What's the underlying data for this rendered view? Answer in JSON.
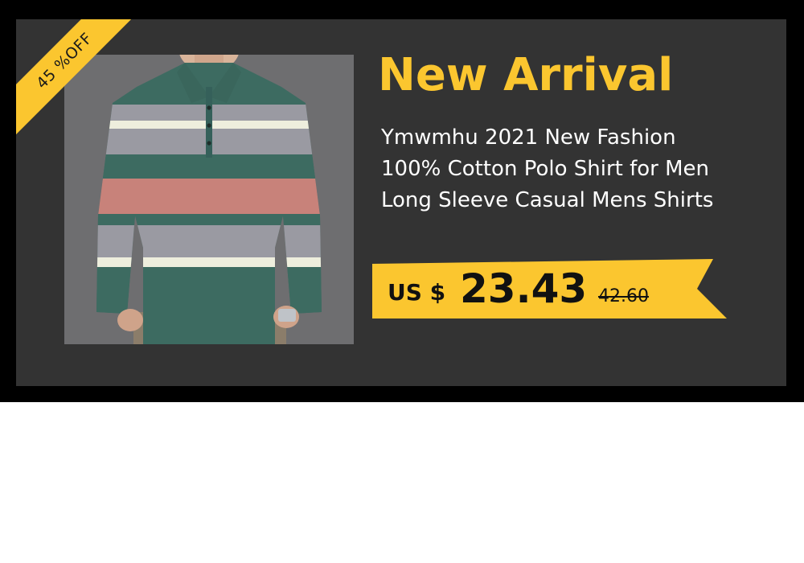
{
  "banner": {
    "discount_label": "45 %OFF",
    "headline": "New Arrival",
    "title_lines": [
      "Ymwmhu 2021 New Fashion",
      "100% Cotton Polo Shirt for Men",
      "Long Sleeve Casual Mens Shirts"
    ],
    "price": {
      "currency": "US $",
      "current": "23.43",
      "original": "42.60"
    },
    "colors": {
      "accent": "#fbc62f",
      "panel": "#333333",
      "frame": "#000000",
      "shirt_green": "#3d6b61",
      "shirt_gray": "#9a9aa2",
      "shirt_pink": "#c8827a",
      "shirt_cream": "#eeeedd"
    },
    "image_icon": "striped-polo-shirt-photo"
  }
}
